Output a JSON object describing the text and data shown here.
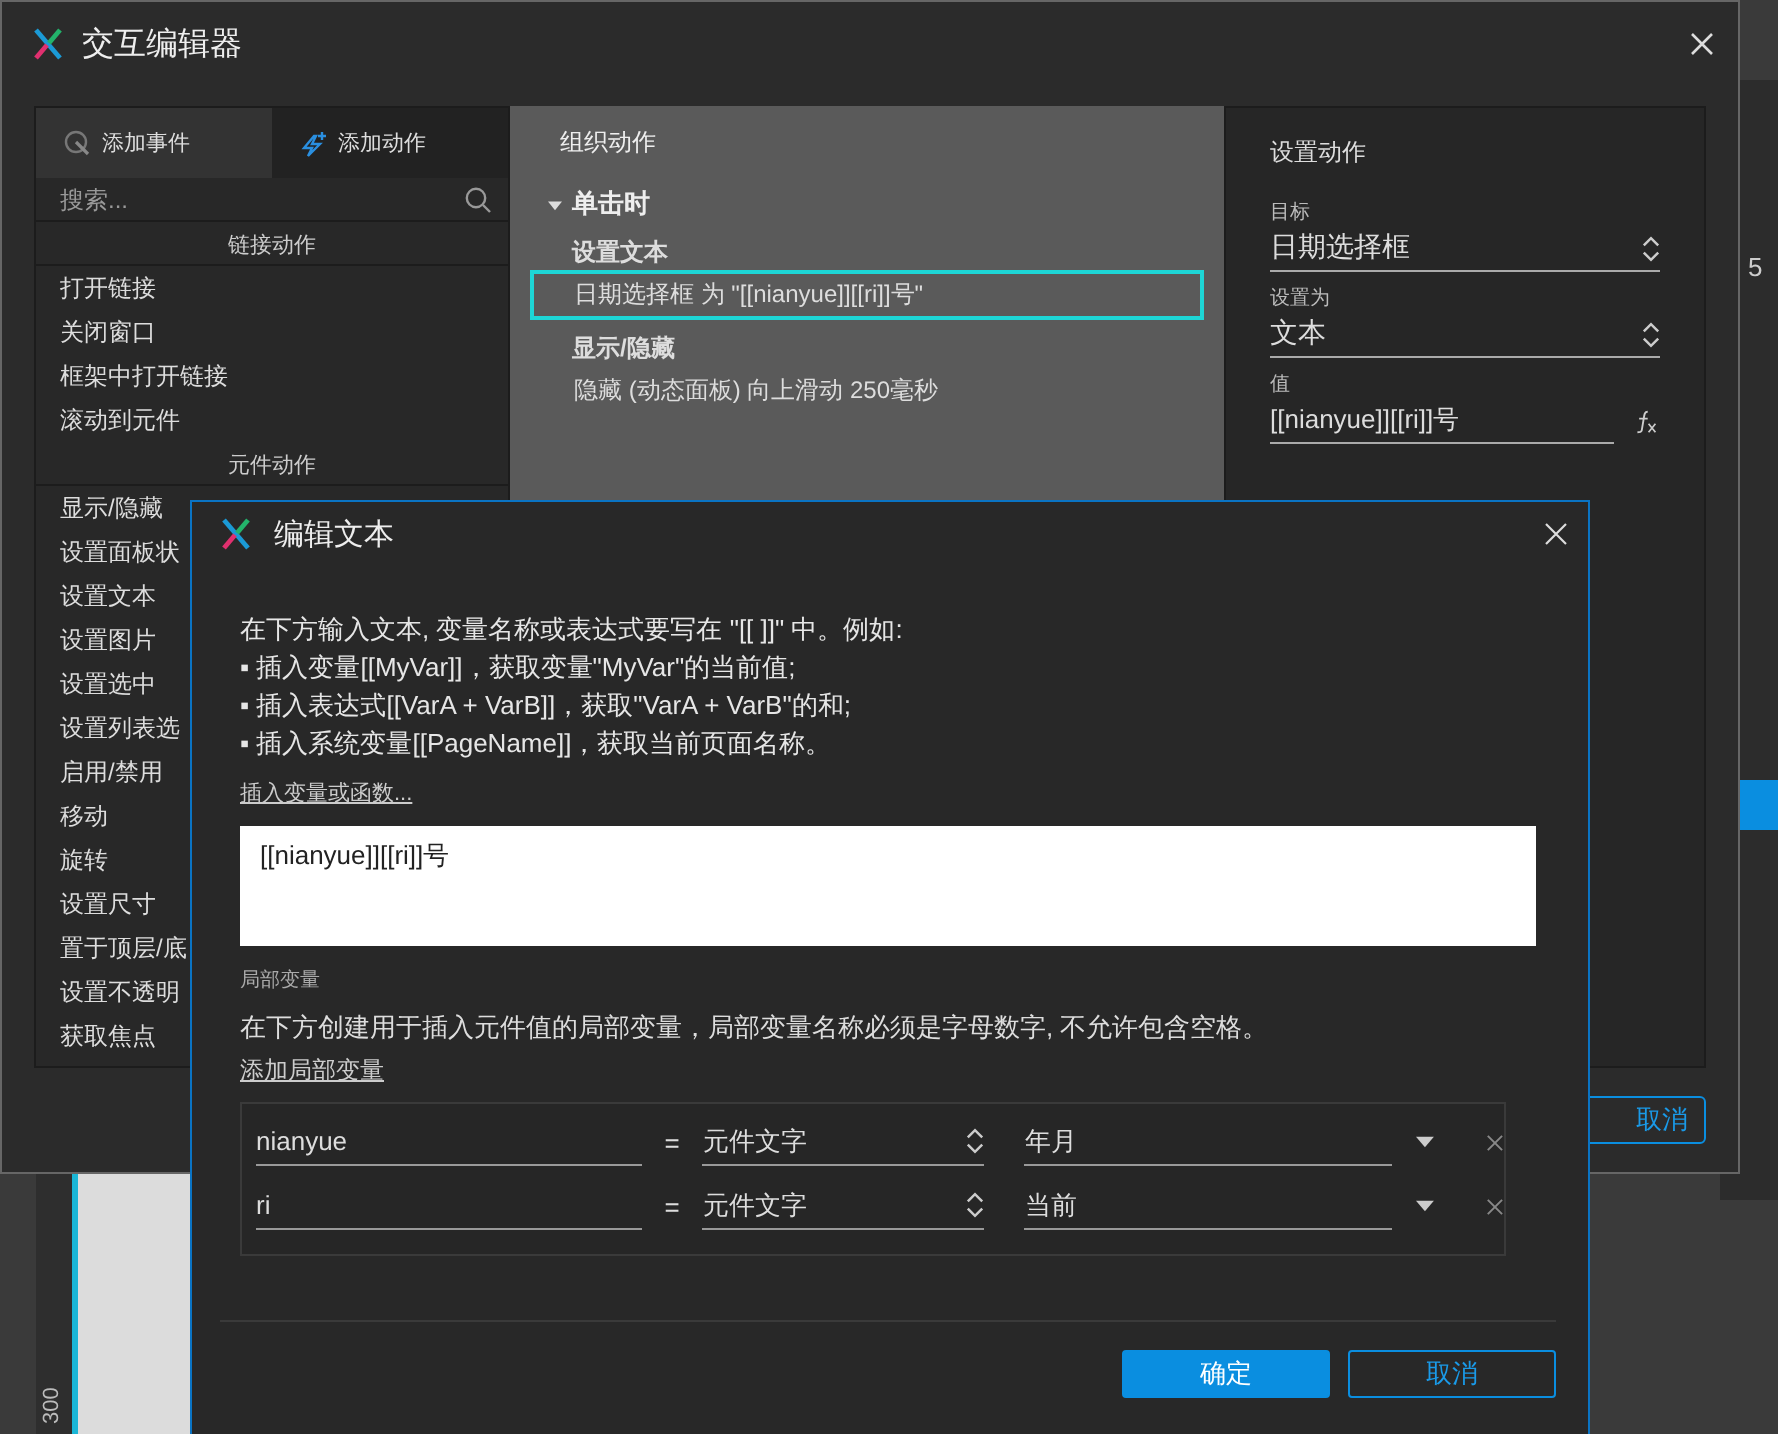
{
  "background": {
    "texts": [
      "5",
      "300"
    ]
  },
  "main_window": {
    "title": "交互编辑器",
    "event_panel": {
      "tabs": [
        {
          "label": "添加事件",
          "kind": "event",
          "selected": false
        },
        {
          "label": "添加动作",
          "kind": "action",
          "selected": true
        }
      ],
      "search": {
        "placeholder": "搜索..."
      },
      "sections": [
        {
          "title": "链接动作",
          "items": [
            "打开链接",
            "关闭窗口",
            "框架中打开链接",
            "滚动到元件"
          ]
        },
        {
          "title": "元件动作",
          "items": [
            "显示/隐藏",
            "设置面板状",
            "设置文本",
            "设置图片",
            "设置选中",
            "设置列表选",
            "启用/禁用",
            "移动",
            "旋转",
            "设置尺寸",
            "置于顶层/底",
            "设置不透明",
            "获取焦点"
          ]
        }
      ]
    },
    "organize": {
      "title": "组织动作",
      "events": [
        {
          "name": "单击时",
          "expanded": true,
          "actions": [
            {
              "name": "设置文本",
              "detail": "日期选择框 为 \"[[nianyue]][[ri]]号\"",
              "selected": true
            },
            {
              "name": "显示/隐藏",
              "detail": "隐藏 (动态面板) 向上滑动 250毫秒",
              "selected": false
            }
          ]
        }
      ]
    },
    "set_action": {
      "title": "设置动作",
      "fields": [
        {
          "label": "目标",
          "value": "日期选择框",
          "kind": "select"
        },
        {
          "label": "设置为",
          "value": "文本",
          "kind": "select"
        },
        {
          "label": "值",
          "value": "[[nianyue]][[ri]]号",
          "kind": "formula"
        }
      ]
    },
    "cancel_button": "取消"
  },
  "edit_dialog": {
    "title": "编辑文本",
    "instructions": [
      "在下方输入文本, 变量名称或表达式要写在 \"[[ ]]\" 中。例如:",
      "▪ 插入变量[[MyVar]]，获取变量\"MyVar\"的当前值;",
      "▪ 插入表达式[[VarA + VarB]]，获取\"VarA + VarB\"的和;",
      "▪ 插入系统变量[[PageName]]，获取当前页面名称。"
    ],
    "insert_link": "插入变量或函数...",
    "text_value": "[[nianyue]][[ri]]号",
    "local_vars_title": "局部变量",
    "local_vars_desc": "在下方创建用于插入元件值的局部变量，局部变量名称必须是字母数字, 不允许包含空格。",
    "add_link": "添加局部变量",
    "variables": [
      {
        "name": "nianyue",
        "equals": "=",
        "source": "元件文字",
        "target": "年月"
      },
      {
        "name": "ri",
        "equals": "=",
        "source": "元件文字",
        "target": "当前"
      }
    ],
    "buttons": [
      {
        "label": "确定",
        "primary": true
      },
      {
        "label": "取消",
        "primary": false
      }
    ]
  }
}
